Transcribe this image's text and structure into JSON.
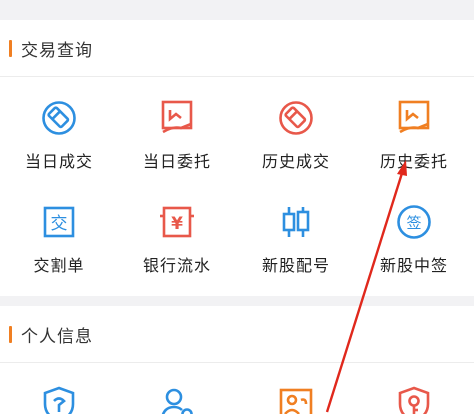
{
  "colors": {
    "accent_orange": "#f07f22",
    "icon_blue": "#2d8fe0",
    "icon_red": "#e8584a",
    "annotation_red": "#e0281c"
  },
  "sections": [
    {
      "title": "交易查询",
      "items": [
        {
          "label": "当日成交",
          "icon": "pen-circle-icon"
        },
        {
          "label": "当日委托",
          "icon": "hand-document-icon"
        },
        {
          "label": "历史成交",
          "icon": "pen-circle-icon"
        },
        {
          "label": "历史委托",
          "icon": "hand-document-icon"
        },
        {
          "label": "交割单",
          "icon": "jiao-badge-icon",
          "glyph": "交"
        },
        {
          "label": "银行流水",
          "icon": "yen-box-icon",
          "glyph": "¥"
        },
        {
          "label": "新股配号",
          "icon": "candlestick-icon"
        },
        {
          "label": "新股中签",
          "icon": "qian-circle-icon",
          "glyph": "签"
        }
      ]
    },
    {
      "title": "个人信息",
      "items": [
        {
          "label": "",
          "icon": "shield-icon"
        },
        {
          "label": "",
          "icon": "user-settings-icon"
        },
        {
          "label": "",
          "icon": "image-user-icon"
        },
        {
          "label": "",
          "icon": "shield-key-icon"
        }
      ]
    }
  ]
}
